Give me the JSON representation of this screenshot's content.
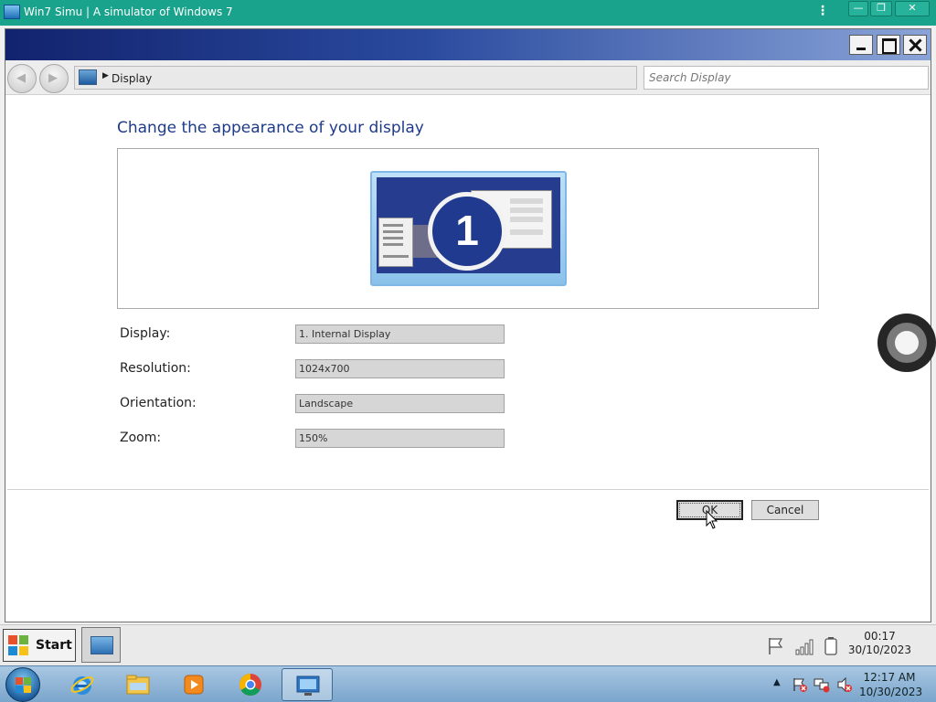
{
  "app_bar": {
    "title": "Win7 Simu | A simulator of Windows 7",
    "menu_icon": "kebab-menu-icon",
    "buttons": [
      "minimize-icon",
      "restore-icon",
      "close-icon"
    ]
  },
  "window": {
    "controls": [
      "minimize-icon",
      "maximize-icon",
      "close-icon"
    ],
    "nav": {
      "back_icon": "back-arrow-icon",
      "forward_icon": "forward-arrow-icon",
      "breadcrumb": "Display",
      "search_placeholder": "Search Display"
    },
    "heading": "Change the appearance of your display",
    "monitor_number": "1",
    "rows": [
      {
        "label": "Display:",
        "value": "1. Internal Display"
      },
      {
        "label": "Resolution:",
        "value": "1024x700"
      },
      {
        "label": "Orientation:",
        "value": "Landscape"
      },
      {
        "label": "Zoom:",
        "value": "150%"
      }
    ],
    "buttons": {
      "ok": "OK",
      "cancel": "Cancel"
    }
  },
  "sim_taskbar": {
    "start_label": "Start",
    "tray_icons": [
      "flag-icon",
      "signal-icon",
      "battery-icon"
    ],
    "time": "00:17",
    "date": "30/10/2023"
  },
  "real_taskbar": {
    "pinned": [
      "internet-explorer-icon",
      "file-explorer-icon",
      "media-player-icon",
      "chrome-icon",
      "display-settings-icon"
    ],
    "tray_icons": [
      "show-hidden-icons-icon",
      "action-center-icon",
      "network-icon",
      "volume-muted-icon"
    ],
    "time": "12:17 AM",
    "date": "10/30/2023"
  },
  "colors": {
    "app_bar": "#1aa38c",
    "heading": "#1e3b8a",
    "title_gradient_start": "#12236e",
    "title_gradient_end": "#8aa4d8"
  }
}
